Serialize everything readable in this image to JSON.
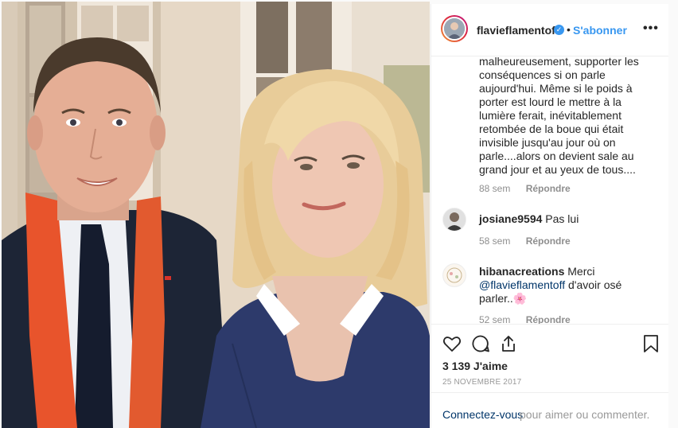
{
  "post": {
    "username": "flavieflamentoff",
    "separator": "•",
    "follow_label": "S'abonner",
    "more_label": "•••",
    "verified_mark": "✓"
  },
  "caption": {
    "lines": [
      "malheureusement, supporter les",
      "conséquences si on parle",
      "aujourd'hui. Même si le poids à",
      "porter est lourd le mettre à la",
      "lumière ferait, inévitablement",
      "retombée de la boue qui était",
      "invisible jusqu'au jour où on",
      "parle....alors on devient sale au",
      "grand jour et au yeux de tous...."
    ],
    "time": "88 sem",
    "reply": "Répondre"
  },
  "comments": [
    {
      "user": "josiane9594",
      "text": "Pas lui",
      "time": "58 sem",
      "reply": "Répondre"
    },
    {
      "user": "hibanacreations",
      "text_before": "Merci",
      "mention": "@flavieflamentoff",
      "text_after": "d'avoir osé",
      "text_line3": "parler..🌸",
      "time": "52 sem",
      "reply": "Répondre"
    }
  ],
  "actions": {
    "likes": "3 139 J'aime",
    "date": "25 NOVEMBRE 2017",
    "icons": [
      "heart-icon",
      "comment-icon",
      "share-icon",
      "bookmark-icon"
    ]
  },
  "login": {
    "link": "Connectez-vous",
    "rest": "pour aimer ou commenter."
  },
  "colors": {
    "accent": "#3897f0",
    "text": "#262626",
    "muted": "#8e8e8e",
    "scarf": "#e8542c",
    "sweater": "#2d3a6b"
  }
}
